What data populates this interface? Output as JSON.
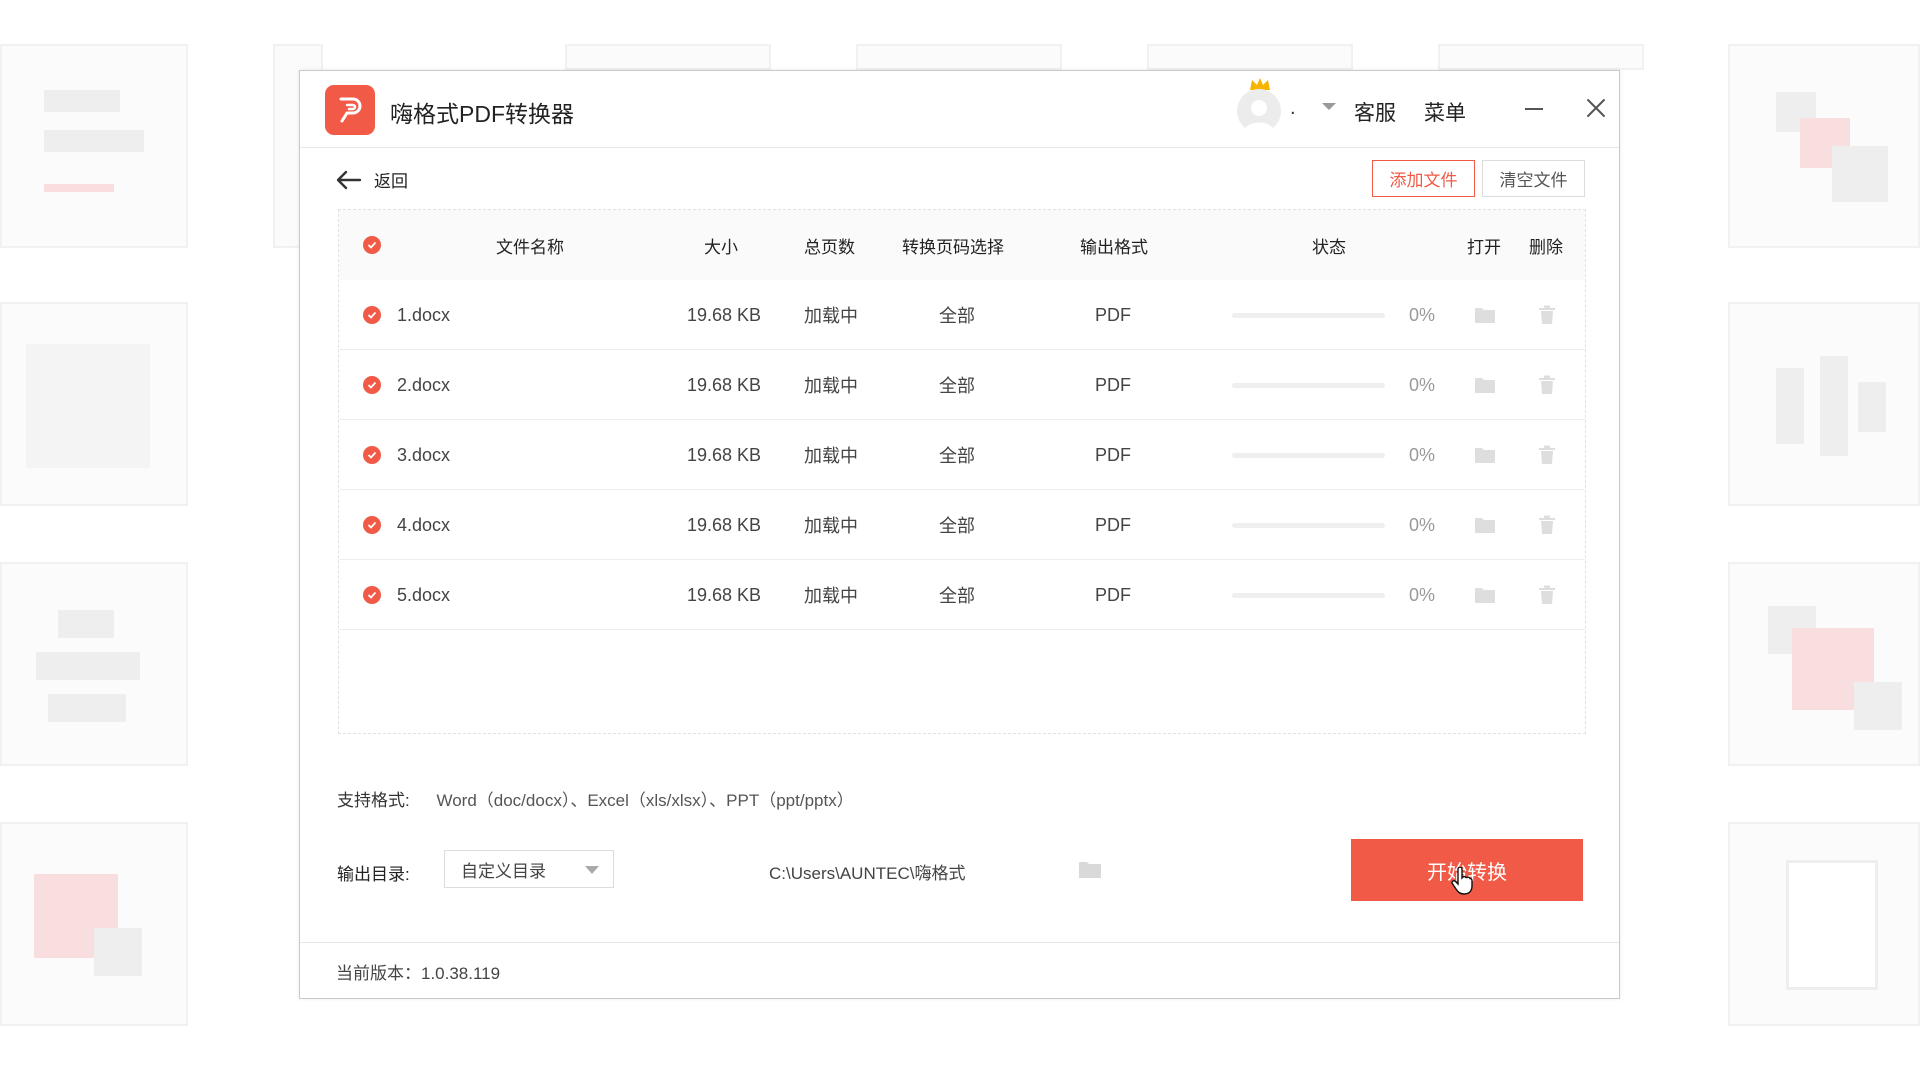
{
  "app": {
    "title": "嗨格式PDF转换器",
    "user_name": ".",
    "customer_service": "客服",
    "menu": "菜单"
  },
  "toolbar": {
    "back_label": "返回",
    "add_files": "添加文件",
    "clear_files": "清空文件"
  },
  "table": {
    "headers": {
      "name": "文件名称",
      "size": "大小",
      "pages": "总页数",
      "page_range": "转换页码选择",
      "output_format": "输出格式",
      "status": "状态",
      "open": "打开",
      "delete": "删除"
    },
    "rows": [
      {
        "name": "1.docx",
        "size": "19.68 KB",
        "pages": "加载中",
        "range": "全部",
        "format": "PDF",
        "progress": 0,
        "percent": "0%"
      },
      {
        "name": "2.docx",
        "size": "19.68 KB",
        "pages": "加载中",
        "range": "全部",
        "format": "PDF",
        "progress": 0,
        "percent": "0%"
      },
      {
        "name": "3.docx",
        "size": "19.68 KB",
        "pages": "加载中",
        "range": "全部",
        "format": "PDF",
        "progress": 0,
        "percent": "0%"
      },
      {
        "name": "4.docx",
        "size": "19.68 KB",
        "pages": "加载中",
        "range": "全部",
        "format": "PDF",
        "progress": 0,
        "percent": "0%"
      },
      {
        "name": "5.docx",
        "size": "19.68 KB",
        "pages": "加载中",
        "range": "全部",
        "format": "PDF",
        "progress": 0,
        "percent": "0%"
      }
    ]
  },
  "support": {
    "label": "支持格式:",
    "formats": "Word（doc/docx）、Excel（xls/xlsx）、PPT（ppt/pptx）"
  },
  "output": {
    "label": "输出目录:",
    "selected": "自定义目录",
    "path": "C:\\Users\\AUNTEC\\嗨格式"
  },
  "start_button": "开始转换",
  "footer": {
    "version": "当前版本：1.0.38.119"
  },
  "colors": {
    "accent": "#f05a46",
    "border": "#dcdcdc",
    "muted": "#999999"
  }
}
